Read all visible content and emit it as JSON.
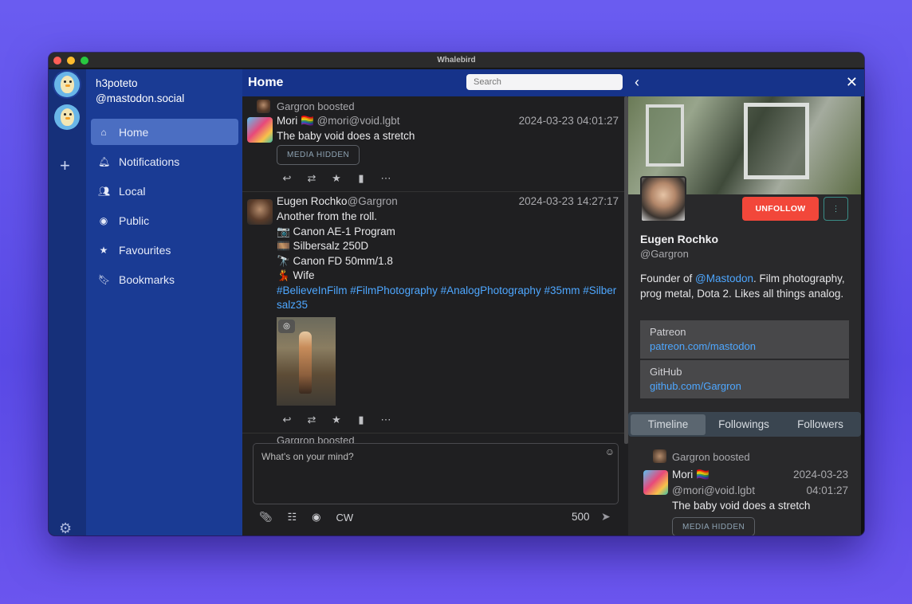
{
  "window": {
    "title": "Whalebird"
  },
  "account": {
    "name": "h3poteto",
    "server": "@mastodon.social"
  },
  "nav": {
    "items": [
      {
        "label": "Home",
        "icon": "home-icon"
      },
      {
        "label": "Notifications",
        "icon": "bell-icon"
      },
      {
        "label": "Local",
        "icon": "users-icon"
      },
      {
        "label": "Public",
        "icon": "globe-icon"
      },
      {
        "label": "Favourites",
        "icon": "star-icon"
      },
      {
        "label": "Bookmarks",
        "icon": "bookmark-icon"
      }
    ]
  },
  "main": {
    "title": "Home",
    "search_placeholder": "Search",
    "posts": [
      {
        "boosted_by": "Gargron boosted",
        "author": "Mori 🏳️‍🌈 ",
        "handle": "@mori@void.lgbt",
        "time": "2024-03-23 04:01:27",
        "text": "The baby void does a stretch",
        "media_label": "MEDIA HIDDEN"
      },
      {
        "author": "Eugen Rochko",
        "handle": "@Gargron",
        "time": "2024-03-23 14:27:17",
        "lines": [
          "Another from the roll.",
          "📷 Canon AE-1 Program",
          "🎞️ Silbersalz 250D",
          "🔭 Canon FD 50mm/1.8",
          "💃 Wife"
        ],
        "hashtags": "#BelieveInFilm #FilmPhotography #AnalogPhotography #35mm #Silbersalz35"
      }
    ],
    "next_boost": "Gargron boosted"
  },
  "compose": {
    "placeholder": "What's on your mind?",
    "cw_label": "CW",
    "char_count": "500"
  },
  "profile": {
    "unfollow_label": "UNFOLLOW",
    "more_label": "⋮",
    "name": "Eugen Rochko",
    "handle": "@Gargron",
    "bio_prefix": "Founder of ",
    "bio_mention": "@Mastodon",
    "bio_suffix": ". Film photography, prog metal, Dota 2. Likes all things analog.",
    "fields": [
      {
        "name": "Patreon",
        "value": "patreon.com/mastodon"
      },
      {
        "name": "GitHub",
        "value": "github.com/Gargron"
      }
    ],
    "tabs": [
      "Timeline",
      "Followings",
      "Followers"
    ],
    "active_tab": 0,
    "post": {
      "boosted_by": "Gargron boosted",
      "author": "Mori 🏳️‍🌈",
      "handle": "@mori@void.lgbt",
      "time": "2024-03-23 04:01:27",
      "text": "The baby void does a stretch",
      "media_label": "MEDIA HIDDEN"
    }
  },
  "colors": {
    "accent": "#1a3b94",
    "header": "#16338a",
    "link": "#4ea7ff",
    "unfollow": "#f2473a"
  }
}
